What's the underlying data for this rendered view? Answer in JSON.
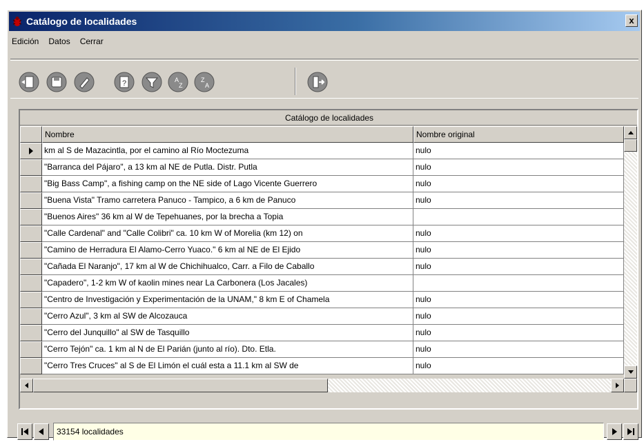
{
  "window": {
    "title": "Catálogo de localidades",
    "close_glyph": "x"
  },
  "menu": {
    "items": [
      "Edición",
      "Datos",
      "Cerrar"
    ]
  },
  "toolbar": {
    "buttons": [
      {
        "icon": "new-record-icon"
      },
      {
        "icon": "save-icon"
      },
      {
        "icon": "edit-icon"
      },
      {
        "icon": "details-icon"
      },
      {
        "icon": "filter-icon"
      },
      {
        "icon": "sort-az-icon"
      },
      {
        "icon": "sort-za-icon"
      },
      {
        "icon": "exit-icon"
      }
    ]
  },
  "grid": {
    "caption": "Catálogo de localidades",
    "columns": [
      "Nombre",
      "Nombre original"
    ],
    "rows": [
      [
        "km al S de Mazacintla, por el camino al Río Moctezuma",
        "nulo"
      ],
      [
        "\"Barranca del Pájaro\", a 13 km al NE de Putla. Distr. Putla",
        "nulo"
      ],
      [
        "\"Big Bass Camp\", a fishing camp on the NE side of Lago Vicente Guerrero",
        "nulo"
      ],
      [
        "\"Buena Vista\" Tramo carretera Panuco - Tampico, a 6 km de Panuco",
        "nulo"
      ],
      [
        "\"Buenos Aires\" 36 km al W de Tepehuanes, por la brecha a Topia",
        ""
      ],
      [
        "\"Calle Cardenal\" and \"Calle Colibri\" ca. 10 km W of Morelia (km 12) on",
        "nulo"
      ],
      [
        "\"Camino de Herradura El Alamo-Cerro Yuaco.\" 6 km al NE de El Ejido",
        "nulo"
      ],
      [
        "\"Cañada El Naranjo\", 17 km al W de Chichihualco, Carr. a Filo de Caballo",
        "nulo"
      ],
      [
        "\"Capadero\", 1-2 km W of kaolin mines near La Carbonera (Los Jacales)",
        ""
      ],
      [
        "\"Centro de Investigación y Experimentación de la UNAM,\" 8 km E of Chamela",
        "nulo"
      ],
      [
        "\"Cerro Azul\", 3 km al SW de Alcozauca",
        "nulo"
      ],
      [
        "\"Cerro del Junquillo\" al SW de Tasquillo",
        "nulo"
      ],
      [
        "\"Cerro Tejón\" ca. 1 km al N de El Parián (junto al río). Dto. Etla.",
        "nulo"
      ],
      [
        "\"Cerro Tres Cruces\" al S de El Limón el cuál esta a 11.1 km al SW de",
        "nulo"
      ]
    ]
  },
  "navigator": {
    "status": "33154 localidades"
  }
}
